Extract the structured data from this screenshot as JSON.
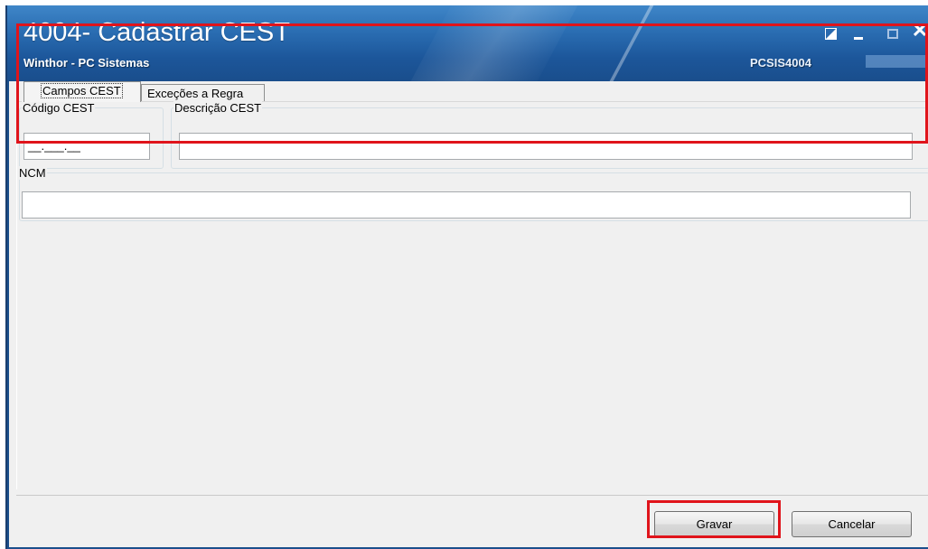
{
  "window": {
    "title": "4004- Cadastrar CEST",
    "subtitle": "Winthor - PC Sistemas",
    "routine_code": "PCSIS4004",
    "controls": {
      "close_glyph": "✕"
    }
  },
  "tabs": [
    {
      "label": "Campos CEST",
      "active": true
    },
    {
      "label": "Exceções a Regra",
      "active": false
    }
  ],
  "form": {
    "code": {
      "label": "Código CEST",
      "value": "__.___.__"
    },
    "description": {
      "label": "Descrição CEST",
      "value": ""
    },
    "ncm": {
      "label": "NCM",
      "value": ""
    }
  },
  "buttons": {
    "save_label": "Gravar",
    "cancel_label": "Cancelar"
  },
  "colors": {
    "highlight": "#e0141b",
    "titlebar": "#2a6db2"
  },
  "icons": {
    "restore": "restore-window-icon",
    "minimize": "minimize-icon",
    "maximize": "maximize-icon",
    "close": "close-icon"
  }
}
